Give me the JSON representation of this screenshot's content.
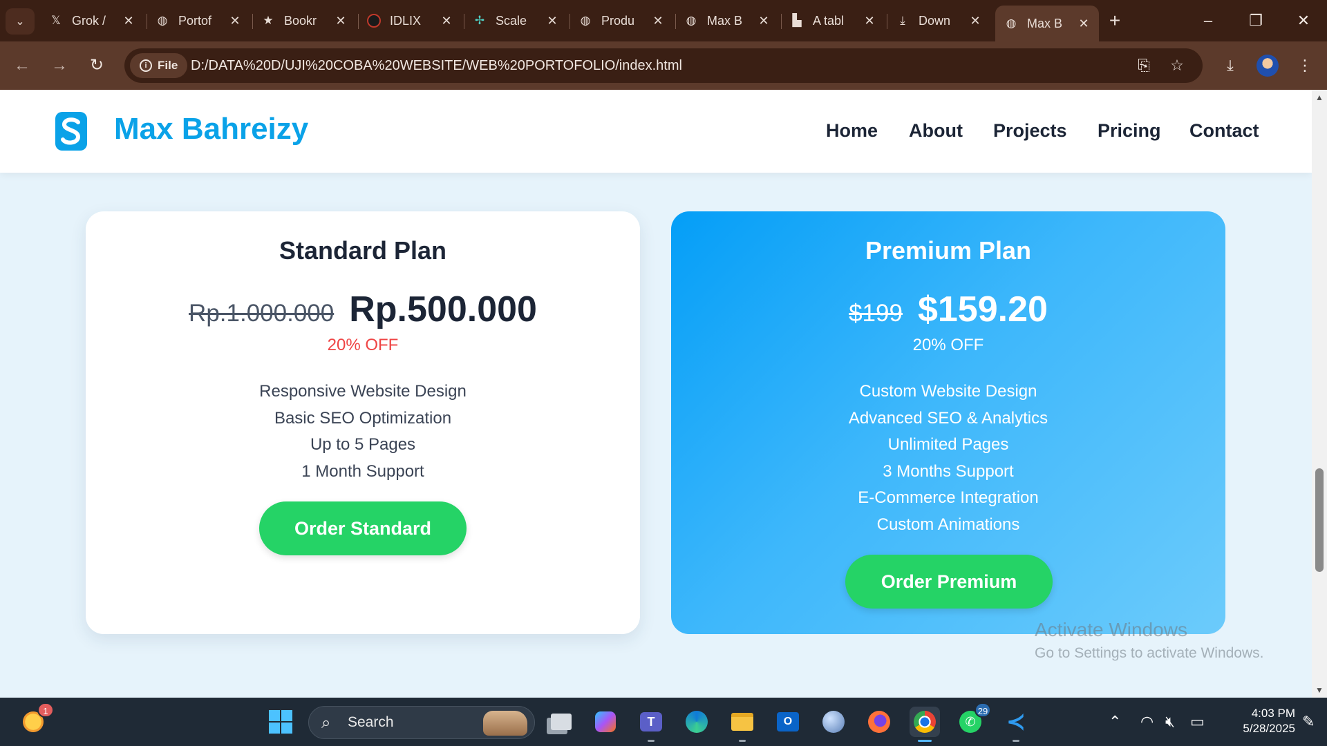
{
  "browser": {
    "tabs": [
      {
        "title": "Grok /",
        "icon": "x-logo-icon",
        "active": false
      },
      {
        "title": "Portof",
        "icon": "globe-icon",
        "active": false
      },
      {
        "title": "Bookr",
        "icon": "star-icon",
        "active": false
      },
      {
        "title": "IDLIX",
        "icon": "idlix-icon",
        "active": false
      },
      {
        "title": "Scale",
        "icon": "scale-icon",
        "active": false
      },
      {
        "title": "Produ",
        "icon": "globe-icon",
        "active": false
      },
      {
        "title": "Max B",
        "icon": "globe-icon",
        "active": false
      },
      {
        "title": "A tabl",
        "icon": "table-icon",
        "active": false
      },
      {
        "title": "Down",
        "icon": "download-icon",
        "active": false
      },
      {
        "title": "Max B",
        "icon": "globe-icon",
        "active": true
      }
    ],
    "address": {
      "chip_label": "File",
      "url": "D:/DATA%20D/UJI%20COBA%20WEBSITE/WEB%20PORTOFOLIO/index.html"
    }
  },
  "site": {
    "brand": "Max Bahreizy",
    "nav": [
      "Home",
      "About",
      "Projects",
      "Pricing",
      "Contact"
    ]
  },
  "plans": [
    {
      "title": "Standard Plan",
      "old_price": "Rp.1.000.000",
      "new_price": "Rp.500.000",
      "discount": "20% OFF",
      "features": [
        "Responsive Website Design",
        "Basic SEO Optimization",
        "Up to 5 Pages",
        "1 Month Support"
      ],
      "button": "Order Standard"
    },
    {
      "title": "Premium Plan",
      "old_price": "$199",
      "new_price": "$159.20",
      "discount": "20% OFF",
      "features": [
        "Custom Website Design",
        "Advanced SEO & Analytics",
        "Unlimited Pages",
        "3 Months Support",
        "E-Commerce Integration",
        "Custom Animations"
      ],
      "button": "Order Premium"
    }
  ],
  "watermark": {
    "line1": "Activate Windows",
    "line2": "Go to Settings to activate Windows."
  },
  "taskbar": {
    "search_placeholder": "Search",
    "notification_count": "1",
    "whatsapp_badge": "29",
    "time": "4:03 PM",
    "date": "5/28/2025"
  },
  "colors": {
    "brand": "#0aa2e8",
    "cta": "#25d366",
    "discount": "#ef4444",
    "browser_frame": "#3a1f14"
  }
}
